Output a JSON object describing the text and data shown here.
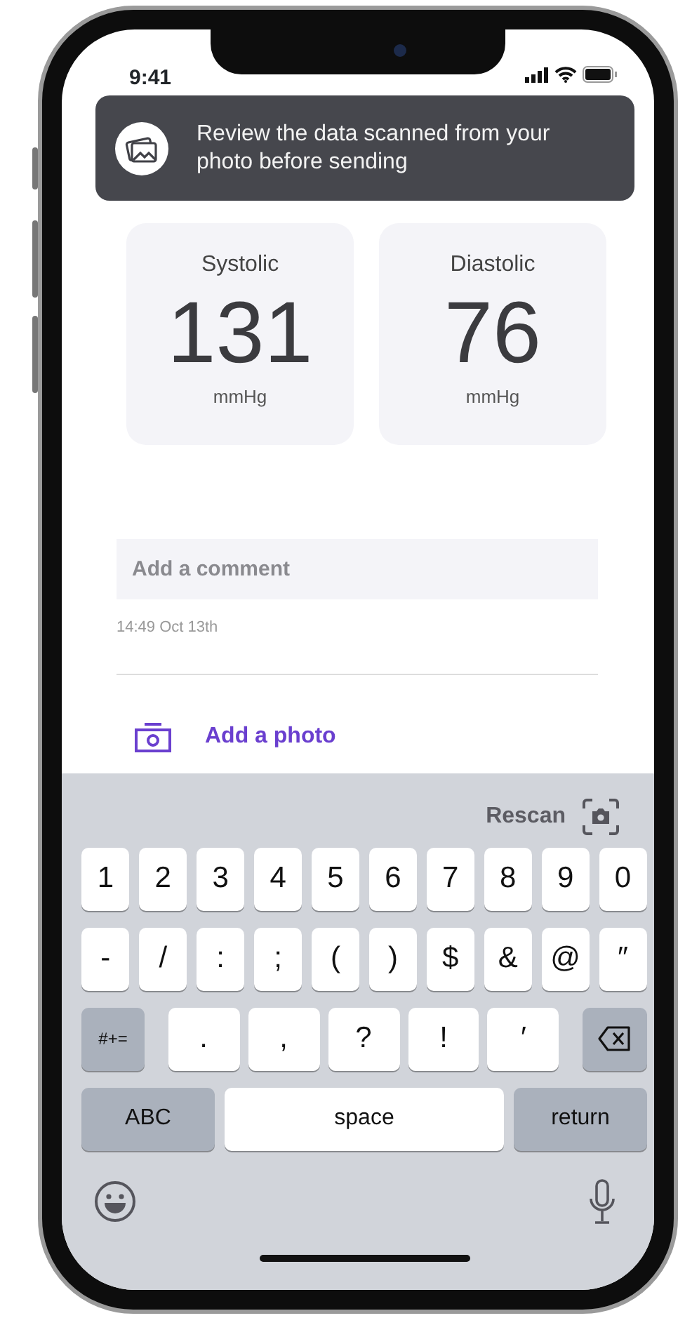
{
  "status_bar": {
    "time": "9:41"
  },
  "toast": {
    "message": "Review the data scanned from your photo before sending"
  },
  "readings": [
    {
      "label": "Systolic",
      "value": "131",
      "unit": "mmHg"
    },
    {
      "label": "Diastolic",
      "value": "76",
      "unit": "mmHg"
    }
  ],
  "comment": {
    "placeholder": "Add a comment"
  },
  "timestamp": "14:49 Oct 13th",
  "add_photo": {
    "label": "Add a photo"
  },
  "keyboard": {
    "toolbar": {
      "label": "Rescan"
    },
    "rows": [
      {
        "keys": [
          {
            "kind": "char",
            "label": "1"
          },
          {
            "kind": "char",
            "label": "2"
          },
          {
            "kind": "char",
            "label": "3"
          },
          {
            "kind": "char",
            "label": "4"
          },
          {
            "kind": "char",
            "label": "5"
          },
          {
            "kind": "char",
            "label": "6"
          },
          {
            "kind": "char",
            "label": "7"
          },
          {
            "kind": "char",
            "label": "8"
          },
          {
            "kind": "char",
            "label": "9"
          },
          {
            "kind": "char",
            "label": "0"
          }
        ]
      },
      {
        "keys": [
          {
            "kind": "char",
            "label": "-"
          },
          {
            "kind": "char",
            "label": "/"
          },
          {
            "kind": "char",
            "label": ":"
          },
          {
            "kind": "char",
            "label": ";"
          },
          {
            "kind": "char",
            "label": "("
          },
          {
            "kind": "char",
            "label": ")"
          },
          {
            "kind": "char",
            "label": "$"
          },
          {
            "kind": "char",
            "label": "&"
          },
          {
            "kind": "char",
            "label": "@"
          },
          {
            "kind": "char",
            "label": "″"
          }
        ]
      },
      {
        "keys": [
          {
            "kind": "function",
            "label": "#+="
          },
          {
            "kind": "char",
            "label": "."
          },
          {
            "kind": "char",
            "label": ","
          },
          {
            "kind": "char",
            "label": "?"
          },
          {
            "kind": "char",
            "label": "!"
          },
          {
            "kind": "char",
            "label": "′"
          },
          {
            "kind": "delete"
          }
        ]
      },
      {
        "keys": [
          {
            "kind": "wide",
            "label": "ABC"
          },
          {
            "kind": "space",
            "label": "space"
          },
          {
            "kind": "wide",
            "label": "return"
          }
        ]
      }
    ]
  }
}
